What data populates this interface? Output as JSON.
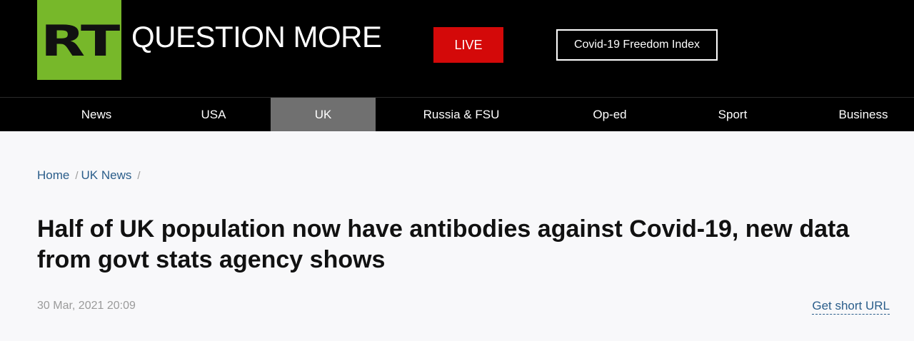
{
  "header": {
    "logo_text": "RT",
    "tagline": "QUESTION MORE",
    "live_label": "LIVE",
    "freedom_index_label": "Covid-19 Freedom Index"
  },
  "nav": {
    "items": [
      {
        "label": "News"
      },
      {
        "label": "USA"
      },
      {
        "label": "UK",
        "active": true
      },
      {
        "label": "Russia & FSU"
      },
      {
        "label": "Op-ed"
      },
      {
        "label": "Sport"
      },
      {
        "label": "Business"
      }
    ]
  },
  "breadcrumb": {
    "home": "Home",
    "section": "UK News",
    "separator": "/"
  },
  "article": {
    "title": "Half of UK population now have antibodies against Covid-19, new data from govt stats agency shows",
    "timestamp": "30 Mar, 2021 20:09",
    "short_url_label": "Get short URL"
  },
  "colors": {
    "logo_green": "#77b82a",
    "live_red": "#d40909",
    "nav_active": "#707070",
    "link_blue": "#2a5d8a"
  }
}
